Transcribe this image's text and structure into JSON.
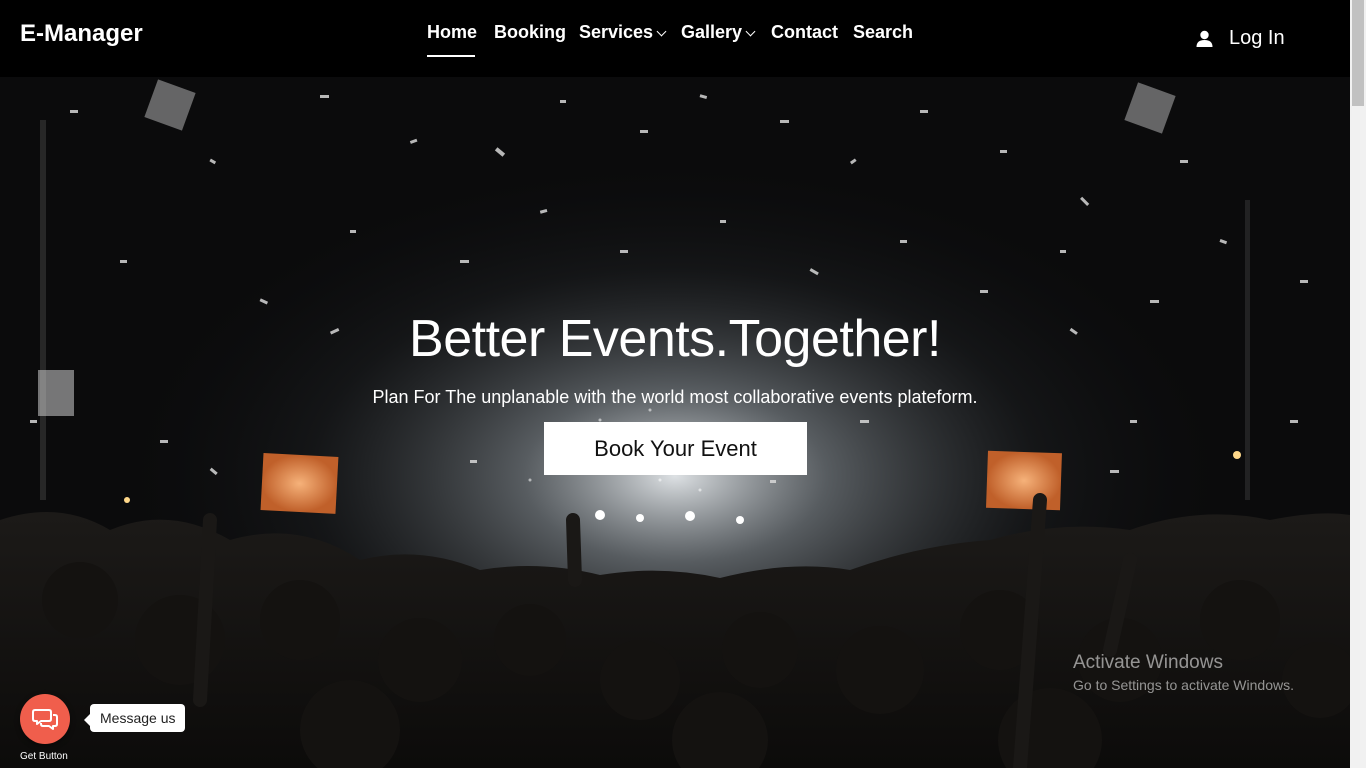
{
  "nav": {
    "brand": "E-Manager",
    "items": [
      {
        "label": "Home",
        "active": true
      },
      {
        "label": "Booking"
      },
      {
        "label": "Services",
        "dropdown": true
      },
      {
        "label": "Gallery",
        "dropdown": true
      },
      {
        "label": "Contact"
      },
      {
        "label": "Search"
      }
    ],
    "login_label": "Log In",
    "login_icon": "user-icon"
  },
  "hero": {
    "title": "Better Events.Together!",
    "subtitle": "Plan For The unplanable with the world most collaborative events plateform.",
    "cta_label": "Book Your Event"
  },
  "watermark": {
    "title": "Activate Windows",
    "subtitle": "Go to Settings to activate Windows."
  },
  "chat_widget": {
    "icon": "chat-bubbles-icon",
    "label": "Message us",
    "brand": "Get Button",
    "color": "#f05e4c"
  }
}
